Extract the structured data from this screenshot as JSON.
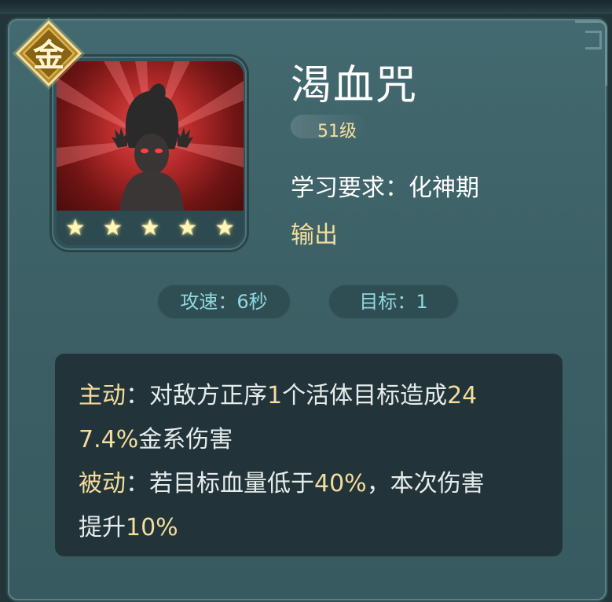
{
  "skill": {
    "rank_badge": "金",
    "name": "渴血咒",
    "level": "51级",
    "requirement": "学习要求：化神期",
    "category": "输出",
    "stars": 5,
    "star_glyph": "★"
  },
  "stats": {
    "attack_speed": "攻速：6秒",
    "target": "目标：1"
  },
  "description": {
    "active_label": "主动",
    "active_line1_prefix": "：对敌方正序",
    "active_line1_num": "1",
    "active_line1_mid": "个活体目标造成",
    "active_line1_val": "24",
    "active_line2_val": "7.4%",
    "active_line2_suffix": "金系伤害",
    "passive_label": "被动",
    "passive_line1_prefix": "：若目标血量低于",
    "passive_line1_val": "40%",
    "passive_line1_suffix": "，本次伤害",
    "passive_line2_prefix": "提升",
    "passive_line2_val": "10%"
  },
  "colors": {
    "gold": "#f3dd9d",
    "panel": "#3e6468",
    "stat_text": "#8fd8de",
    "icon_red": "#c43434"
  }
}
